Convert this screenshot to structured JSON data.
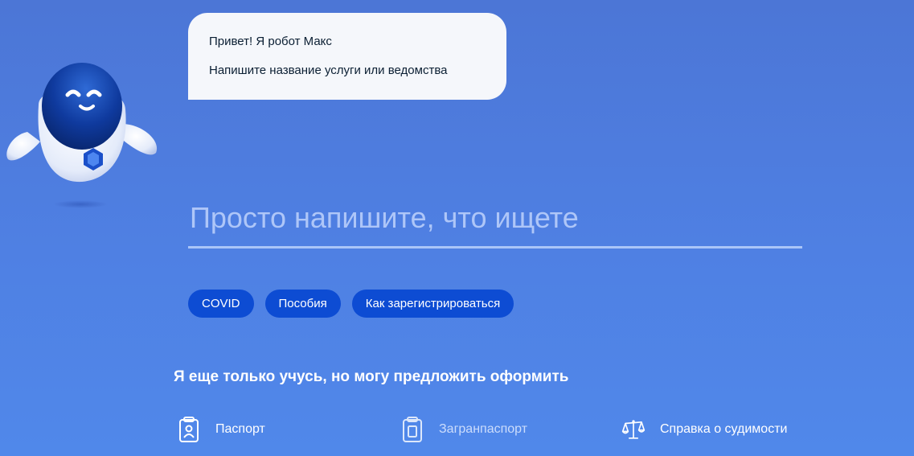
{
  "assistant": {
    "greeting": "Привет! Я робот Макс",
    "prompt": "Напишите название услуги или ведомства"
  },
  "search": {
    "placeholder": "Просто напишите, что ищете"
  },
  "chips": [
    {
      "label": "COVID"
    },
    {
      "label": "Пособия"
    },
    {
      "label": "Как зарегистрироваться"
    }
  ],
  "suggestions": {
    "title": "Я еще только учусь, но могу предложить оформить",
    "items": [
      {
        "label": "Паспорт",
        "icon": "passport-icon"
      },
      {
        "label": "Загранпаспорт",
        "icon": "international-passport-icon"
      },
      {
        "label": "Справка о судимости",
        "icon": "scales-icon"
      }
    ]
  },
  "colors": {
    "background": "#4f80e3",
    "chip": "#0d4cd3",
    "bubble": "#f5f7fb",
    "bubble_text": "#0b1f33"
  }
}
